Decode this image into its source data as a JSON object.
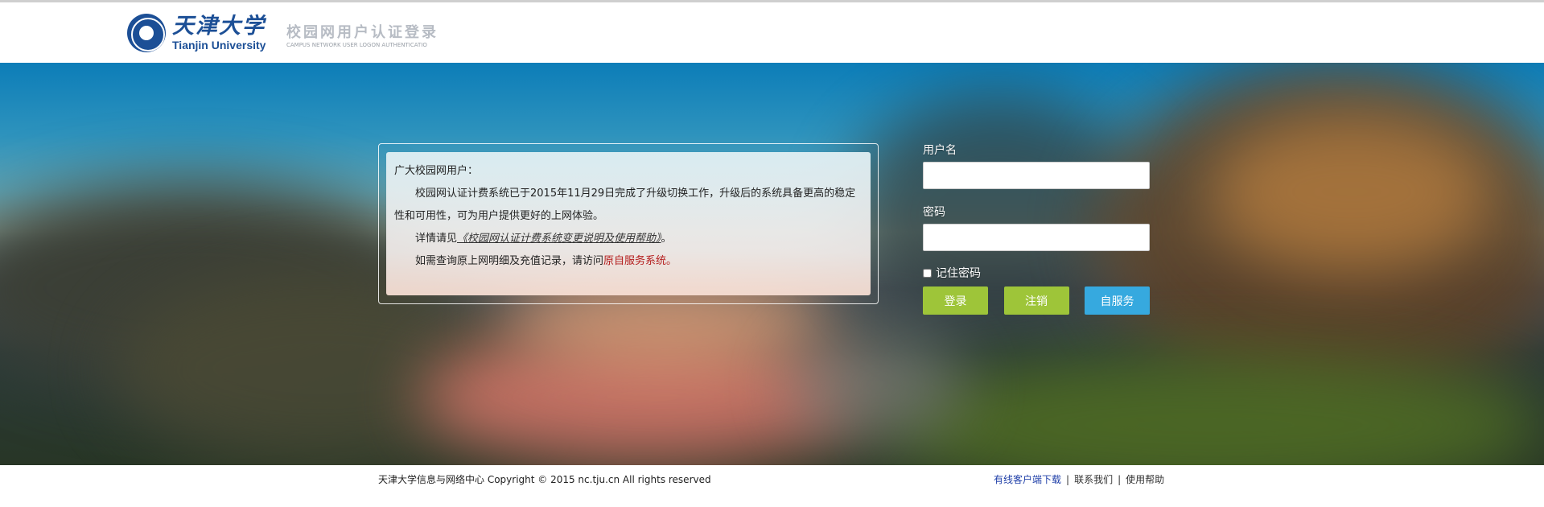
{
  "header": {
    "university_cn": "天津大学",
    "university_en": "Tianjin University",
    "system_cn": "校园网用户认证登录",
    "system_en": "CAMPUS NETWORK USER LOGON AUTHENTICATIO"
  },
  "notice": {
    "greeting": "广大校园网用户：",
    "line1": "校园网认证计费系统已于2015年11月29日完成了升级切换工作，升级后的系统具备更高的稳定性和可用性，可为用户提供更好的上网体验。",
    "line2_prefix": "详情请见",
    "line2_link": "《校园网认证计费系统变更说明及使用帮助》",
    "line2_suffix": "。",
    "line3_prefix": "如需查询原上网明细及充值记录，请访问",
    "line3_link": "原自服务系统",
    "line3_suffix": "。"
  },
  "form": {
    "username_label": "用户名",
    "username_value": "",
    "password_label": "密码",
    "password_value": "",
    "remember_label": "记住密码",
    "remember_checked": false,
    "login_button": "登录",
    "logout_button": "注销",
    "self_service_button": "自服务"
  },
  "footer": {
    "copyright": "天津大学信息与网络中心 Copyright © 2015 nc.tju.cn All rights reserved",
    "link_download": "有线客户端下载",
    "link_contact": "联系我们",
    "link_help": "使用帮助",
    "separator": "|"
  },
  "colors": {
    "brand_blue": "#1c4f96",
    "button_green": "#9ec539",
    "button_blue": "#36a9df",
    "link_red": "#b41c1c",
    "footer_link_blue": "#1f3fa8"
  }
}
